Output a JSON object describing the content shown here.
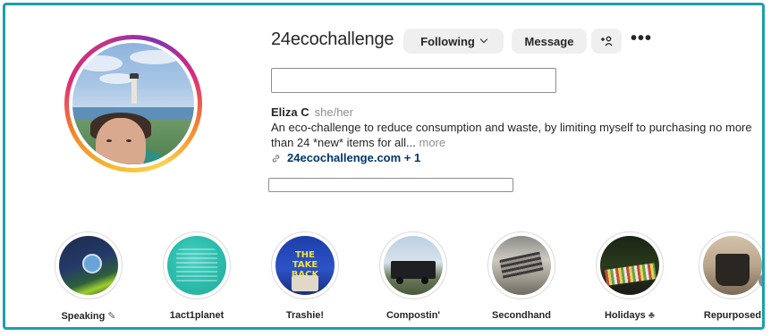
{
  "profile": {
    "username": "24ecochallenge",
    "following_label": "Following",
    "message_label": "Message",
    "add_user_label": "+☺",
    "more_label": "•••",
    "name": "Eliza C",
    "pronouns": "she/her",
    "bio": "An eco-challenge to reduce consumption and waste, by limiting myself to purchasing no more than 24 *new* items for all...",
    "bio_more": "more",
    "link": "24ecochallenge.com + 1"
  },
  "highlights": [
    {
      "label": "Speaking",
      "suffix": "✎"
    },
    {
      "label": "1act1planet",
      "suffix": ""
    },
    {
      "label": "Trashie!",
      "suffix": ""
    },
    {
      "label": "Compostin'",
      "suffix": ""
    },
    {
      "label": "Secondhand",
      "suffix": ""
    },
    {
      "label": "Holidays",
      "suffix": "♣"
    },
    {
      "label": "Repurposed",
      "suffix": ""
    }
  ],
  "trashie_image_text": "THE TAKE BACK BAG",
  "colors": {
    "frame_border": "#1a9fb0",
    "link": "#00376b",
    "button_bg": "#efefef"
  },
  "icons": {
    "chevron": "chevron-down-icon",
    "link": "link-icon",
    "scroll": "chevron-right-icon"
  }
}
